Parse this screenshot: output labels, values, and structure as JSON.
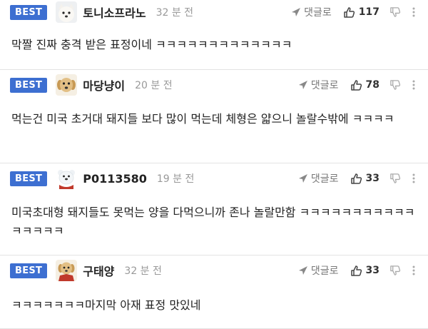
{
  "comments": [
    {
      "badge": "BEST",
      "nickname": "토니소프라노",
      "time": "32 분 전",
      "reply_label": "댓글로",
      "likes": "117",
      "avatar": "white-dog-avatar",
      "text": "막짤 진짜 충격 받은 표정이네 ㅋㅋㅋㅋㅋㅋㅋㅋㅋㅋㅋㅋㅋ"
    },
    {
      "badge": "BEST",
      "nickname": "마당냥이",
      "time": "20 분 전",
      "reply_label": "댓글로",
      "likes": "78",
      "avatar": "puppy-avatar",
      "text": "먹는건 미국 초거대 돼지들 보다 많이 먹는데 체형은 얇으니 놀랄수밖에 ㅋㅋㅋㅋ"
    },
    {
      "badge": "BEST",
      "nickname": "P0113580",
      "time": "19 분 전",
      "reply_label": "댓글로",
      "likes": "33",
      "avatar": "polar-bear-avatar",
      "text": "미국초대형 돼지들도 못먹는 양을 다먹으니까 존나 놀랄만함 ㅋㅋㅋㅋㅋㅋㅋㅋㅋㅋㅋㅋㅋㅋㅋㅋ"
    },
    {
      "badge": "BEST",
      "nickname": "구태양",
      "time": "32 분 전",
      "reply_label": "댓글로",
      "likes": "33",
      "avatar": "puppy-cape-avatar",
      "text": "ㅋㅋㅋㅋㅋㅋㅋ마지막 아재 표정 맛있네"
    }
  ],
  "colors": {
    "badge": "#3d6fd1",
    "divider": "#e3e3e3",
    "muted": "#999999"
  }
}
